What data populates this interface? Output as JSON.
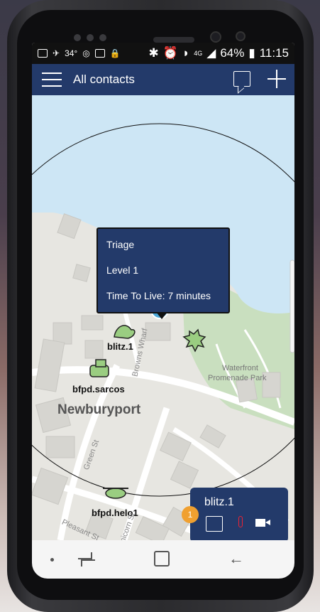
{
  "status": {
    "left_text": "34°",
    "battery": "64%",
    "time": "11:15",
    "network": "4G"
  },
  "appbar": {
    "title": "All contacts",
    "chat_icon": "chat-bubble-icon",
    "add_icon": "plus-icon"
  },
  "map": {
    "place_label": "Newburyport",
    "park_label_1": "Waterfront",
    "park_label_2": "Promenade Park",
    "streets": [
      "Green St",
      "Pleasant St",
      "Unicorn St",
      "Browns Wharf"
    ],
    "contacts": [
      {
        "name": "blitz.1"
      },
      {
        "name": "bfpd.sarcos"
      },
      {
        "name": "bfpd.helo1"
      }
    ]
  },
  "tooltip": {
    "line1": "Triage",
    "line2": "Level 1",
    "line3": "Time To Live: 7 minutes"
  },
  "popup": {
    "name": "blitz.1",
    "badge_count": "1"
  },
  "colors": {
    "appbar": "#233a6a",
    "water": "#cde6f5",
    "park": "#c9dfbf",
    "badge": "#f0a030",
    "video": "#1a6ce0"
  }
}
